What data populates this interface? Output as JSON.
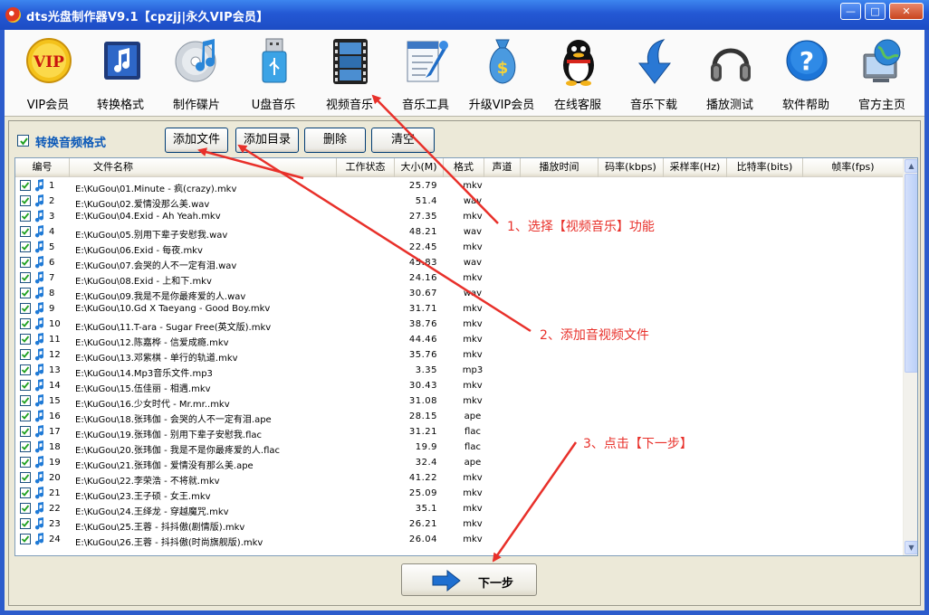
{
  "window": {
    "title": "dts光盘制作器V9.1【cpzjj|永久VIP会员】",
    "min": "—",
    "max": "□",
    "close": "✕"
  },
  "toolbar": {
    "items": [
      {
        "label": "VIP会员",
        "icon": "vip-badge-icon",
        "vip_text": "VIP"
      },
      {
        "label": "转换格式",
        "icon": "music-note-icon"
      },
      {
        "label": "制作碟片",
        "icon": "cd-disc-icon"
      },
      {
        "label": "U盘音乐",
        "icon": "usb-drive-icon"
      },
      {
        "label": "视频音乐",
        "icon": "film-strip-icon"
      },
      {
        "label": "音乐工具",
        "icon": "tools-icon"
      },
      {
        "label": "升级VIP会员",
        "icon": "money-bag-icon"
      },
      {
        "label": "在线客服",
        "icon": "penguin-icon"
      },
      {
        "label": "音乐下载",
        "icon": "download-arrow-icon"
      },
      {
        "label": "播放测试",
        "icon": "headphones-icon"
      },
      {
        "label": "软件帮助",
        "icon": "help-icon"
      },
      {
        "label": "官方主页",
        "icon": "globe-computer-icon"
      }
    ]
  },
  "options": {
    "convert_label": "转换音频格式",
    "convert_checked": true
  },
  "actions": {
    "add_file": "添加文件",
    "add_dir": "添加目录",
    "delete": "删除",
    "clear": "清空"
  },
  "table": {
    "columns": [
      "编号",
      "文件名称",
      "工作状态",
      "大小(M)",
      "格式",
      "声道",
      "播放时间",
      "码率(kbps)",
      "采样率(Hz)",
      "比特率(bits)",
      "帧率(fps)"
    ],
    "rows": [
      {
        "num": "1",
        "name": "E:\\KuGou\\01.Minute - 疯(crazy).mkv",
        "size": "25.79",
        "format": "mkv"
      },
      {
        "num": "2",
        "name": "E:\\KuGou\\02.爱情没那么美.wav",
        "size": "51.4",
        "format": "wav"
      },
      {
        "num": "3",
        "name": "E:\\KuGou\\04.Exid - Ah Yeah.mkv",
        "size": "27.35",
        "format": "mkv"
      },
      {
        "num": "4",
        "name": "E:\\KuGou\\05.别用下辈子安慰我.wav",
        "size": "48.21",
        "format": "wav"
      },
      {
        "num": "5",
        "name": "E:\\KuGou\\06.Exid - 每夜.mkv",
        "size": "22.45",
        "format": "mkv"
      },
      {
        "num": "6",
        "name": "E:\\KuGou\\07.会哭的人不一定有泪.wav",
        "size": "45.83",
        "format": "wav"
      },
      {
        "num": "7",
        "name": "E:\\KuGou\\08.Exid - 上和下.mkv",
        "size": "24.16",
        "format": "mkv"
      },
      {
        "num": "8",
        "name": "E:\\KuGou\\09.我是不是你最疼爱的人.wav",
        "size": "30.67",
        "format": "wav"
      },
      {
        "num": "9",
        "name": "E:\\KuGou\\10.Gd X Taeyang - Good Boy.mkv",
        "size": "31.71",
        "format": "mkv"
      },
      {
        "num": "10",
        "name": "E:\\KuGou\\11.T-ara - Sugar Free(英文版).mkv",
        "size": "38.76",
        "format": "mkv"
      },
      {
        "num": "11",
        "name": "E:\\KuGou\\12.陈嘉桦 - 信爱成瘾.mkv",
        "size": "44.46",
        "format": "mkv"
      },
      {
        "num": "12",
        "name": "E:\\KuGou\\13.邓紫棋 - 单行的轨道.mkv",
        "size": "35.76",
        "format": "mkv"
      },
      {
        "num": "13",
        "name": "E:\\KuGou\\14.Mp3音乐文件.mp3",
        "size": "3.35",
        "format": "mp3"
      },
      {
        "num": "14",
        "name": "E:\\KuGou\\15.伍佳丽 - 相遇.mkv",
        "size": "30.43",
        "format": "mkv"
      },
      {
        "num": "15",
        "name": "E:\\KuGou\\16.少女时代 - Mr.mr..mkv",
        "size": "31.08",
        "format": "mkv"
      },
      {
        "num": "16",
        "name": "E:\\KuGou\\18.张玮伽 - 会哭的人不一定有泪.ape",
        "size": "28.15",
        "format": "ape"
      },
      {
        "num": "17",
        "name": "E:\\KuGou\\19.张玮伽 - 别用下辈子安慰我.flac",
        "size": "31.21",
        "format": "flac"
      },
      {
        "num": "18",
        "name": "E:\\KuGou\\20.张玮伽 - 我是不是你最疼爱的人.flac",
        "size": "19.9",
        "format": "flac"
      },
      {
        "num": "19",
        "name": "E:\\KuGou\\21.张玮伽 - 爱情没有那么美.ape",
        "size": "32.4",
        "format": "ape"
      },
      {
        "num": "20",
        "name": "E:\\KuGou\\22.李荣浩 - 不将就.mkv",
        "size": "41.22",
        "format": "mkv"
      },
      {
        "num": "21",
        "name": "E:\\KuGou\\23.王子硕 - 女王.mkv",
        "size": "25.09",
        "format": "mkv"
      },
      {
        "num": "22",
        "name": "E:\\KuGou\\24.王绎龙 - 穿越魔咒.mkv",
        "size": "35.1",
        "format": "mkv"
      },
      {
        "num": "23",
        "name": "E:\\KuGou\\25.王蓉 - 抖抖傲(剧情版).mkv",
        "size": "26.21",
        "format": "mkv"
      },
      {
        "num": "24",
        "name": "E:\\KuGou\\26.王蓉 - 抖抖傲(时尚旗舰版).mkv",
        "size": "26.04",
        "format": "mkv"
      }
    ]
  },
  "next": {
    "label": "下一步"
  },
  "annotations": {
    "step1": "1、选择【视频音乐】功能",
    "step2": "2、添加音视频文件",
    "step3": "3、点击【下一步】"
  }
}
